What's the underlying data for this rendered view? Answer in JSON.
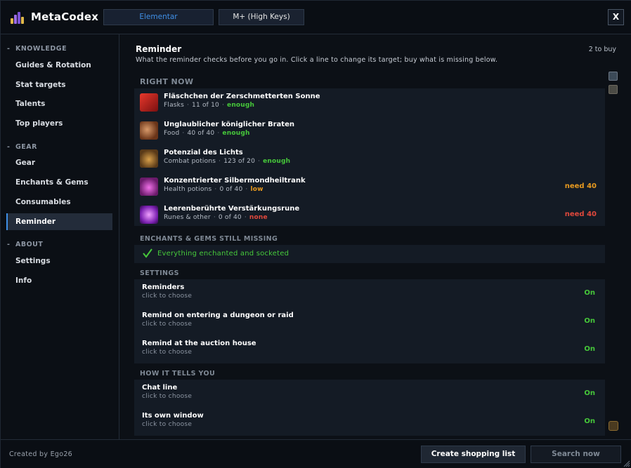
{
  "app": {
    "title": "MetaCodex",
    "close_label": "X",
    "spec_tabs": [
      {
        "label": "Elementar"
      },
      {
        "label": "M+ (High Keys)"
      }
    ]
  },
  "sidebar": {
    "sections": [
      {
        "dash": "-",
        "title": "KNOWLEDGE",
        "items": [
          {
            "label": "Guides & Rotation"
          },
          {
            "label": "Stat targets"
          },
          {
            "label": "Talents"
          },
          {
            "label": "Top players"
          }
        ]
      },
      {
        "dash": "-",
        "title": "GEAR",
        "items": [
          {
            "label": "Gear"
          },
          {
            "label": "Enchants & Gems"
          },
          {
            "label": "Consumables"
          },
          {
            "label": "Reminder"
          }
        ]
      },
      {
        "dash": "-",
        "title": "ABOUT",
        "items": [
          {
            "label": "Settings"
          },
          {
            "label": "Info"
          }
        ]
      }
    ],
    "active_item": "Reminder"
  },
  "main": {
    "title": "Reminder",
    "subtitle": "What the reminder checks before you go in. Click a line to change its target; buy what is missing below.",
    "buy_count": "2 to buy",
    "right_now": {
      "heading": "RIGHT NOW",
      "dot": "·",
      "items": [
        {
          "name": "Fläschchen der Zerschmetterten Sonne",
          "category": "Flasks",
          "count": "11 of 10",
          "status": "enough",
          "need": "",
          "icon": "flask-icon",
          "color": "#c0201c"
        },
        {
          "name": "Unglaublicher königlicher Braten",
          "category": "Food",
          "count": "40 of 40",
          "status": "enough",
          "need": "",
          "icon": "food-icon",
          "color": "#8a4a2a"
        },
        {
          "name": "Potenzial des Lichts",
          "category": "Combat potions",
          "count": "123 of 20",
          "status": "enough",
          "need": "",
          "icon": "potion-icon",
          "color": "#7a5a30"
        },
        {
          "name": "Konzentrierter Silbermondheiltrank",
          "category": "Health potions",
          "count": "0 of 40",
          "status": "low",
          "need": "need 40",
          "icon": "health-potion-icon",
          "color": "#c040c0"
        },
        {
          "name": "Leerenberührte Verstärkungsrune",
          "category": "Runes & other",
          "count": "0 of 40",
          "status": "none",
          "need": "need 40",
          "icon": "rune-icon",
          "color": "#a040d0"
        }
      ]
    },
    "enchants": {
      "heading": "ENCHANTS & GEMS STILL MISSING",
      "message": "Everything enchanted and socketed"
    },
    "settings": {
      "heading": "SETTINGS",
      "items": [
        {
          "name": "Reminders",
          "hint": "click to choose",
          "value": "On"
        },
        {
          "name": "Remind on entering a dungeon or raid",
          "hint": "click to choose",
          "value": "On"
        },
        {
          "name": "Remind at the auction house",
          "hint": "click to choose",
          "value": "On"
        }
      ]
    },
    "how": {
      "heading": "HOW IT TELLS YOU",
      "items": [
        {
          "name": "Chat line",
          "hint": "click to choose",
          "value": "On"
        },
        {
          "name": "Its own window",
          "hint": "click to choose",
          "value": "On"
        }
      ]
    }
  },
  "footer": {
    "credit": "Created by Ego26",
    "create_list_label": "Create shopping list",
    "search_label": "Search now"
  },
  "colors": {
    "accent": "#3f8fe6",
    "enough": "#46c83a",
    "low": "#e89a1f",
    "none": "#e0483c"
  }
}
